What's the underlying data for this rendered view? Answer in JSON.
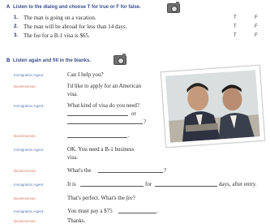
{
  "section_a": {
    "letter": "A",
    "instruction": "Listen to the dialog and choose T for true or F for false.",
    "statements": [
      {
        "num": "1.",
        "text": "The man is going on a vacation.",
        "t": "T",
        "f": "F"
      },
      {
        "num": "2.",
        "text": "The man will be abroad for less than 14 days.",
        "t": "T",
        "f": "F"
      },
      {
        "num": "3.",
        "text": "The fee for a B-1 visa is $65.",
        "t": "T",
        "f": "F"
      }
    ]
  },
  "section_b": {
    "letter": "B",
    "instruction": "Listen again and fill in the blanks.",
    "dialog": [
      {
        "speaker": "Immigration Agent",
        "text": "Can I help you?"
      },
      {
        "speaker": "Businessman",
        "text": "I'd like to apply for an American",
        "text2": "visa."
      },
      {
        "speaker": "Immigration Agent",
        "text": "What kind of visa do you need?",
        "or": "or",
        "q": "?"
      },
      {
        "speaker": "Businessman",
        "tail": "."
      },
      {
        "speaker": "Immigration Agent",
        "text": "OK. You need a B-1 business",
        "text2": "visa."
      },
      {
        "speaker": "Businessman",
        "text": "What's the",
        "tail": "?"
      },
      {
        "speaker": "Immigration Agent",
        "text": "It is",
        "for": "for",
        "tail": "days, after entry."
      },
      {
        "speaker": "Businessman",
        "text": "That's perfect. What's the",
        "em": "fee",
        "tail": "?"
      },
      {
        "speaker": "Immigration Agent",
        "text": "You must pay a $75",
        "tail": "."
      },
      {
        "speaker": "Businessman",
        "text": "Thanks."
      }
    ]
  },
  "icons": {
    "audio": "camera-audio-icon"
  },
  "colors": {
    "heading": "#3a4e8c",
    "agent": "#5a78b8",
    "businessman": "#d97a6a"
  }
}
